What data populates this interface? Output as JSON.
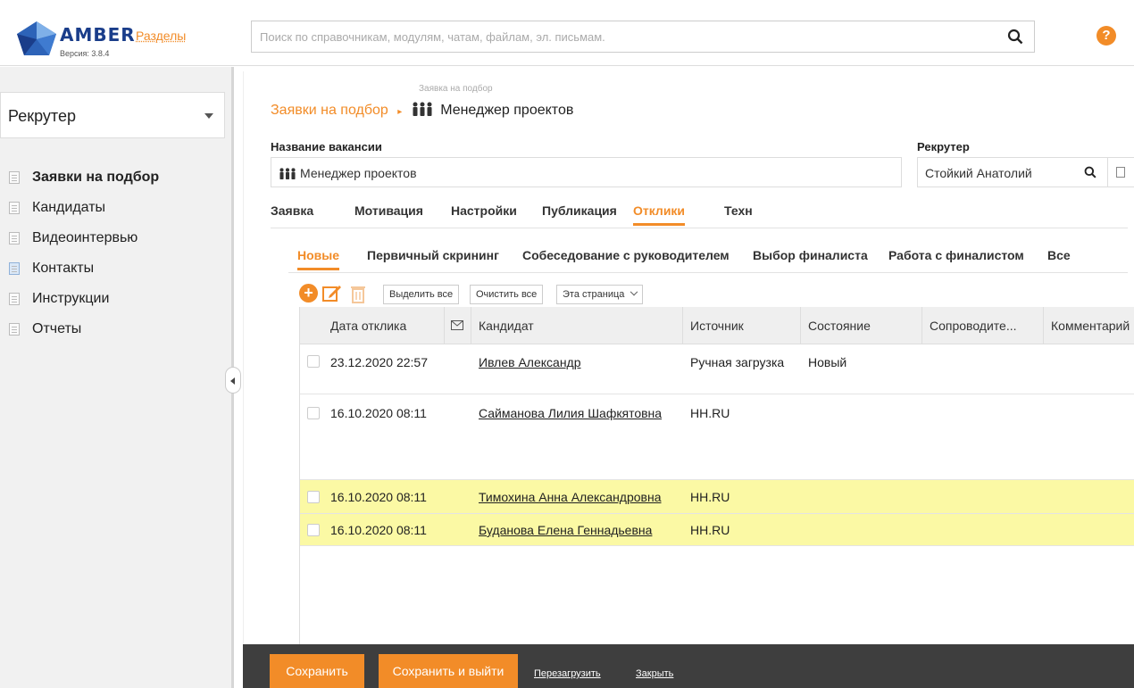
{
  "header": {
    "logo": "AMBER",
    "version": "Версия: 3.8.4",
    "sections_link": "Разделы",
    "search_placeholder": "Поиск по справочникам, модулям, чатам, файлам, эл. письмам.",
    "help": "?"
  },
  "sidebar": {
    "role": "Рекрутер",
    "items": [
      {
        "label": "Заявки на подбор",
        "active": true
      },
      {
        "label": "Кандидаты"
      },
      {
        "label": "Видеоинтервью"
      },
      {
        "label": "Контакты"
      },
      {
        "label": "Инструкции"
      },
      {
        "label": "Отчеты"
      }
    ]
  },
  "breadcrumb": {
    "small": "Заявка на подбор",
    "parent": "Заявки на подбор",
    "sep": "▸",
    "current": "Менеджер проектов"
  },
  "form": {
    "vacancy_label": "Название вакансии",
    "vacancy_value": "Менеджер проектов",
    "recruiter_label": "Рекрутер",
    "recruiter_value": "Стойкий Анатолий"
  },
  "tabs": [
    "Заявка",
    "Мотивация",
    "Настройки",
    "Публикация",
    "Отклики",
    "Техн"
  ],
  "active_tab": "Отклики",
  "subtabs": [
    "Новые",
    "Первичный скрининг",
    "Собеседование с руководителем",
    "Выбор финалиста",
    "Работа с финалистом",
    "Все"
  ],
  "toolbar": {
    "add": "+",
    "select_all": "Выделить все",
    "clear_all": "Очистить все",
    "page_select": "Эта страница"
  },
  "grid": {
    "columns": [
      "Дата отклика",
      "",
      "Кандидат",
      "Источник",
      "Состояние",
      "Сопроводите...",
      "Комментарий"
    ],
    "rows": [
      {
        "date": "23.12.2020 22:57",
        "candidate": "Ивлев Александр",
        "source": "Ручная загрузка",
        "status": "Новый",
        "highlight": false
      },
      {
        "date": "16.10.2020 08:11",
        "candidate": "Сайманова Лилия Шафкятовна",
        "source": "HH.RU",
        "status": "",
        "highlight": false
      },
      {
        "date": "16.10.2020 08:11",
        "candidate": "Тимохина Анна Александровна",
        "source": "HH.RU",
        "status": "",
        "highlight": true
      },
      {
        "date": "16.10.2020 08:11",
        "candidate": "Буданова Елена Геннадьевна",
        "source": "HH.RU",
        "status": "",
        "highlight": true
      }
    ]
  },
  "footer": {
    "save": "Сохранить",
    "save_exit": "Сохранить и выйти",
    "reload": "Перезагрузить",
    "close": "Закрыть"
  },
  "colors": {
    "accent": "#f28c28",
    "highlight": "#fbf9a4",
    "footer_bg": "#3e3e3e",
    "brand": "#1a3d8a"
  }
}
